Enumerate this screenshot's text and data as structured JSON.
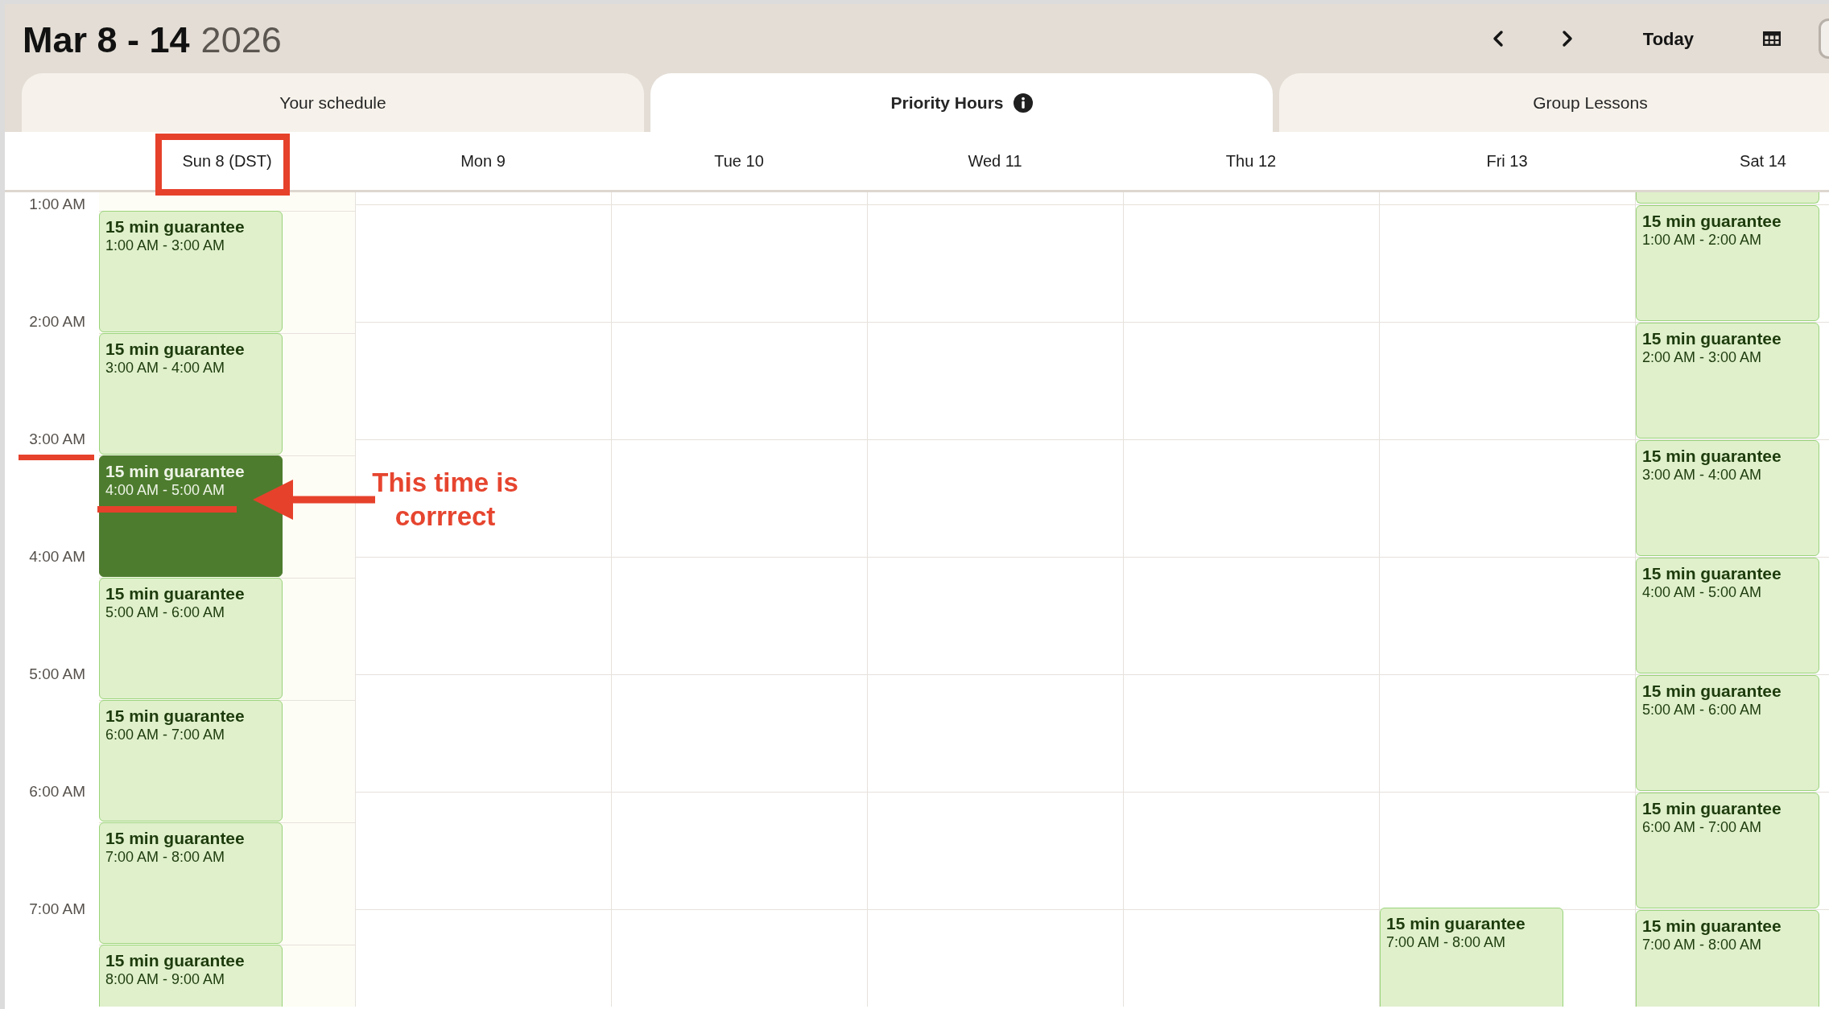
{
  "header": {
    "date_range": "Mar 8 - 14",
    "year": "2026",
    "today_button": "Today"
  },
  "tabs": [
    {
      "label": "Your schedule",
      "selected": false,
      "info": false
    },
    {
      "label": "Priority Hours",
      "selected": true,
      "info": true
    },
    {
      "label": "Group Lessons",
      "selected": false,
      "info": false
    }
  ],
  "time_labels": [
    "1:00 AM",
    "2:00 AM",
    "3:00 AM",
    "4:00 AM",
    "5:00 AM",
    "6:00 AM",
    "7:00 AM"
  ],
  "days": [
    {
      "label": "Sun 8 (DST)",
      "kind": "dst",
      "events": [
        {
          "kind": "slot",
          "title": "15 min guarantee",
          "time": "1:00 AM - 3:00 AM",
          "selected": false
        },
        {
          "kind": "slot",
          "title": "15 min guarantee",
          "time": "3:00 AM - 4:00 AM",
          "selected": false
        },
        {
          "kind": "slot",
          "title": "15 min guarantee",
          "time": "4:00 AM - 5:00 AM",
          "selected": true
        },
        {
          "kind": "slot",
          "title": "15 min guarantee",
          "time": "5:00 AM - 6:00 AM",
          "selected": false
        },
        {
          "kind": "slot",
          "title": "15 min guarantee",
          "time": "6:00 AM - 7:00 AM",
          "selected": false
        },
        {
          "kind": "slot",
          "title": "15 min guarantee",
          "time": "7:00 AM - 8:00 AM",
          "selected": false
        },
        {
          "kind": "slot",
          "title": "15 min guarantee",
          "time": "8:00 AM - 9:00 AM",
          "selected": false
        }
      ]
    },
    {
      "label": "Mon 9",
      "kind": "standard"
    },
    {
      "label": "Tue 10",
      "kind": "standard"
    },
    {
      "label": "Wed 11",
      "kind": "standard"
    },
    {
      "label": "Thu 12",
      "kind": "standard"
    },
    {
      "label": "Fri 13",
      "kind": "standard",
      "events": [
        {
          "kind": "slot",
          "title": "15 min guarantee",
          "time": "7:00 AM - 8:00 AM",
          "selected": false
        }
      ]
    },
    {
      "label": "Sat 14",
      "kind": "standard",
      "events": [
        {
          "kind": "clipped",
          "selected": false
        },
        {
          "kind": "slot",
          "title": "15 min guarantee",
          "time": "1:00 AM - 2:00 AM",
          "selected": false
        },
        {
          "kind": "slot",
          "title": "15 min guarantee",
          "time": "2:00 AM - 3:00 AM",
          "selected": false
        },
        {
          "kind": "slot",
          "title": "15 min guarantee",
          "time": "3:00 AM - 4:00 AM",
          "selected": false
        },
        {
          "kind": "slot",
          "title": "15 min guarantee",
          "time": "4:00 AM - 5:00 AM",
          "selected": false
        },
        {
          "kind": "slot",
          "title": "15 min guarantee",
          "time": "5:00 AM - 6:00 AM",
          "selected": false
        },
        {
          "kind": "slot",
          "title": "15 min guarantee",
          "time": "6:00 AM - 7:00 AM",
          "selected": false
        },
        {
          "kind": "slot",
          "title": "15 min guarantee",
          "time": "7:00 AM - 8:00 AM",
          "selected": false
        }
      ]
    }
  ],
  "annotation": {
    "text": "This time is corrrect"
  }
}
